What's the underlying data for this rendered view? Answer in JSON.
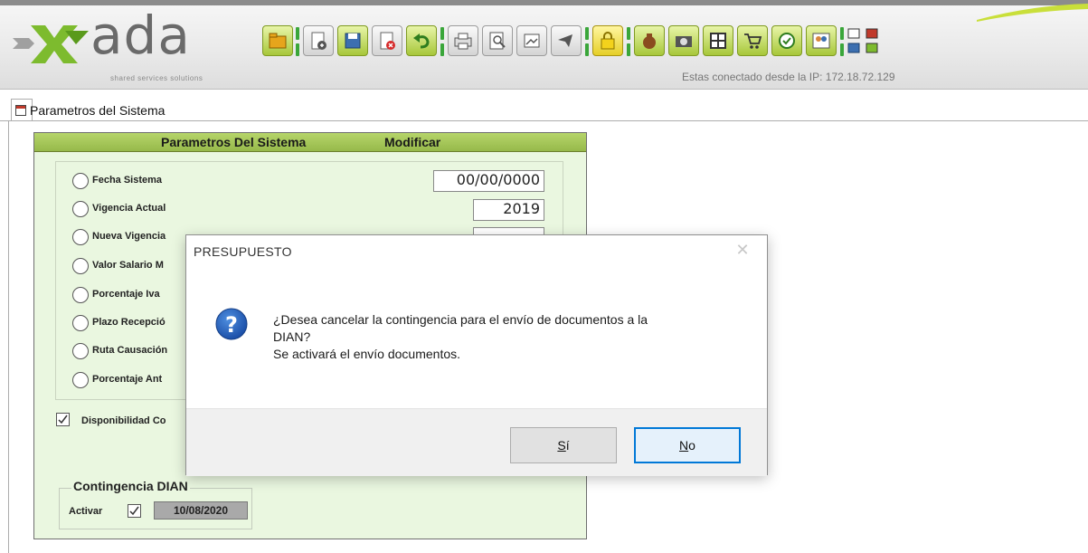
{
  "app": {
    "logo_text": "ada",
    "logo_subtitle": "shared services solutions",
    "ip_label": "Estas conectado desde la IP: 172.18.72.129"
  },
  "toolbar": {
    "icons": [
      "open-folder-icon",
      "new-document-icon",
      "save-icon",
      "delete-icon",
      "undo-icon",
      "print-icon",
      "preview-icon",
      "export-icon",
      "send-icon",
      "lock-icon",
      "money-bag-icon",
      "camera-icon",
      "grid-icon",
      "cart-icon",
      "approve-icon",
      "users-icon",
      "windows-icon",
      "exit-icon"
    ]
  },
  "tab": {
    "label": "Parametros del Sistema"
  },
  "panel": {
    "title": "Parametros Del Sistema",
    "mode": "Modificar",
    "rows": [
      {
        "label": "Fecha Sistema",
        "value": "00/00/0000"
      },
      {
        "label": "Vigencia Actual",
        "value": "2019"
      },
      {
        "label": "Nueva Vigencia",
        "value": ""
      },
      {
        "label": "Valor Salario M",
        "value": ""
      },
      {
        "label": "Porcentaje Iva",
        "value": ""
      },
      {
        "label": "Plazo Recepció",
        "value": ""
      },
      {
        "label": "Ruta Causación",
        "value": ""
      },
      {
        "label": "Porcentaje Ant",
        "value": ""
      }
    ],
    "disponibilidad_label": "Disponibilidad Co",
    "contingencia": {
      "title": "Contingencia DIAN",
      "activar_label": "Activar",
      "date": "10/08/2020"
    }
  },
  "dialog": {
    "title": "PRESUPUESTO",
    "close": "✕",
    "message_line1": "¿Desea cancelar la contingencia para el envío de documentos a la",
    "message_line2": "DIAN?",
    "message_line3": "Se activará el envío documentos.",
    "btn_si_label": "í",
    "btn_si_mnemonic": "S",
    "btn_no_label": "o",
    "btn_no_mnemonic": "N"
  }
}
